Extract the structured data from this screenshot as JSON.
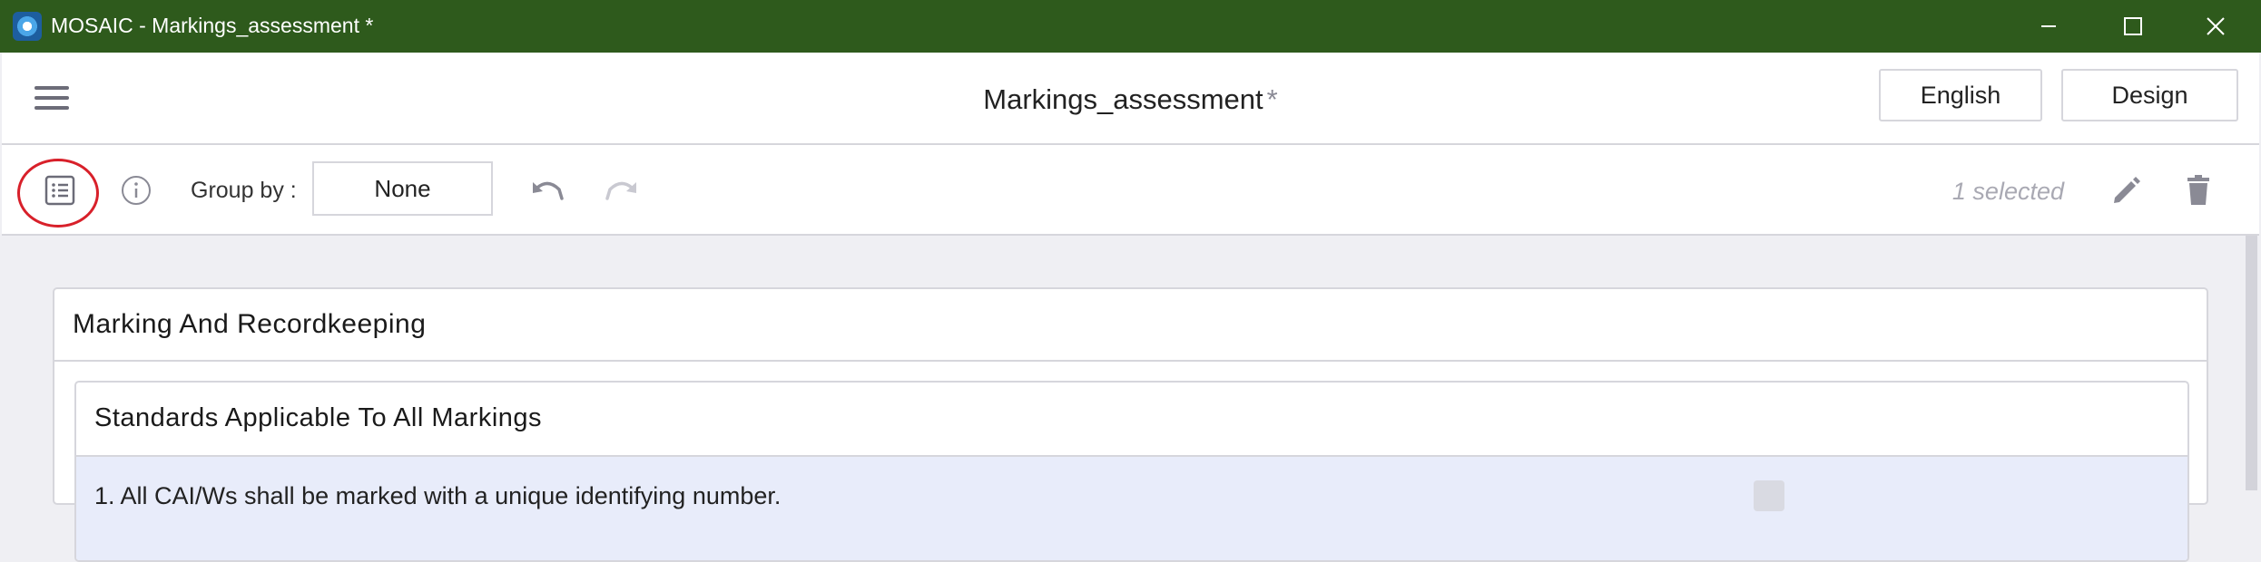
{
  "window": {
    "title": "MOSAIC - Markings_assessment *"
  },
  "header": {
    "title": "Markings_assessment",
    "unsaved_marker": "*",
    "language_button": "English",
    "design_button": "Design"
  },
  "toolbar": {
    "group_by_label": "Group by :",
    "group_by_value": "None",
    "selected_count": "1 selected"
  },
  "content": {
    "section_title": "Marking And Recordkeeping",
    "subsection_title": "Standards Applicable To All Markings",
    "first_item_text": "1.   All CAI/Ws shall be marked with a unique identifying number."
  },
  "colors": {
    "titlebar": "#2e5a1c",
    "highlight": "#d8202a",
    "row_selected": "#e8ecfa"
  },
  "icons": [
    "app-icon",
    "minimize-icon",
    "maximize-icon",
    "close-icon",
    "menu-icon",
    "list-view-icon",
    "info-icon",
    "undo-icon",
    "redo-icon",
    "edit-icon",
    "delete-icon"
  ]
}
